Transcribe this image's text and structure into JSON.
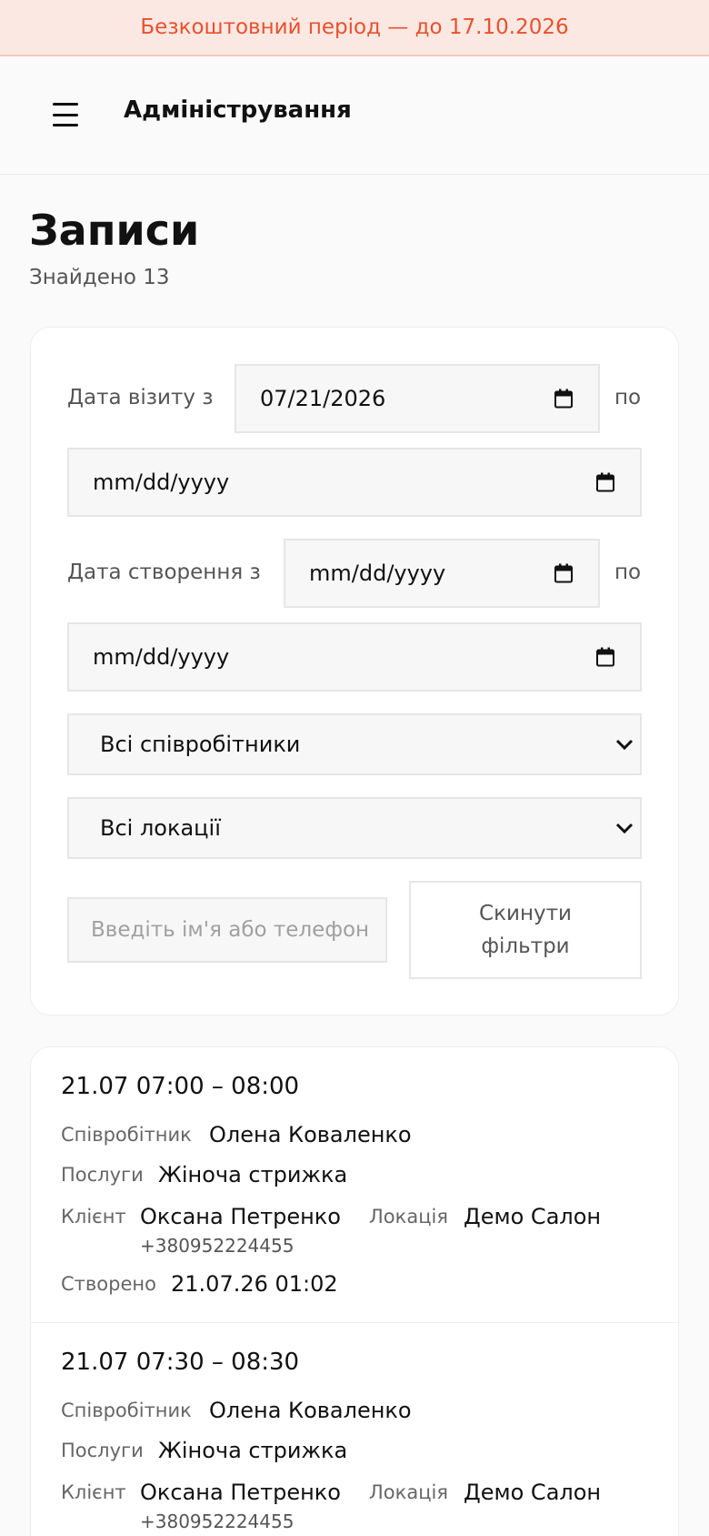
{
  "banner": {
    "text": "Безкоштовний період — до 17.10.2026"
  },
  "header": {
    "title": "Адміністрування",
    "menu_icon": "hamburger-icon"
  },
  "page": {
    "title": "Записи",
    "found": "Знайдено 13"
  },
  "filters": {
    "visit_label": "Дата візиту з",
    "visit_from": "07/21/2026",
    "to_label": "по",
    "visit_to": "mm/dd/yyyy",
    "created_label": "Дата створення з",
    "created_from": "mm/dd/yyyy",
    "created_to": "mm/dd/yyyy",
    "staff_selected": "Всі співробітники",
    "location_selected": "Всі локації",
    "search_placeholder": "Введіть ім'я або телефон",
    "search_value": "",
    "reset_label": "Скинути фільтри"
  },
  "labels": {
    "staff": "Співробітник",
    "services": "Послуги",
    "client": "Клієнт",
    "location": "Локація",
    "created": "Створено"
  },
  "bookings": [
    {
      "time": "21.07 07:00 – 08:00",
      "staff": "Олена Коваленко",
      "service": "Жіноча стрижка",
      "client": "Оксана Петренко",
      "phone": "+380952224455",
      "location": "Демо Салон",
      "created": "21.07.26 01:02"
    },
    {
      "time": "21.07 07:30 – 08:30",
      "staff": "Олена Коваленко",
      "service": "Жіноча стрижка",
      "client": "Оксана Петренко",
      "phone": "+380952224455",
      "location": "Демо Салон",
      "created": ""
    }
  ],
  "colors": {
    "accent": "#e8512e",
    "banner_bg": "#fce8e2"
  }
}
